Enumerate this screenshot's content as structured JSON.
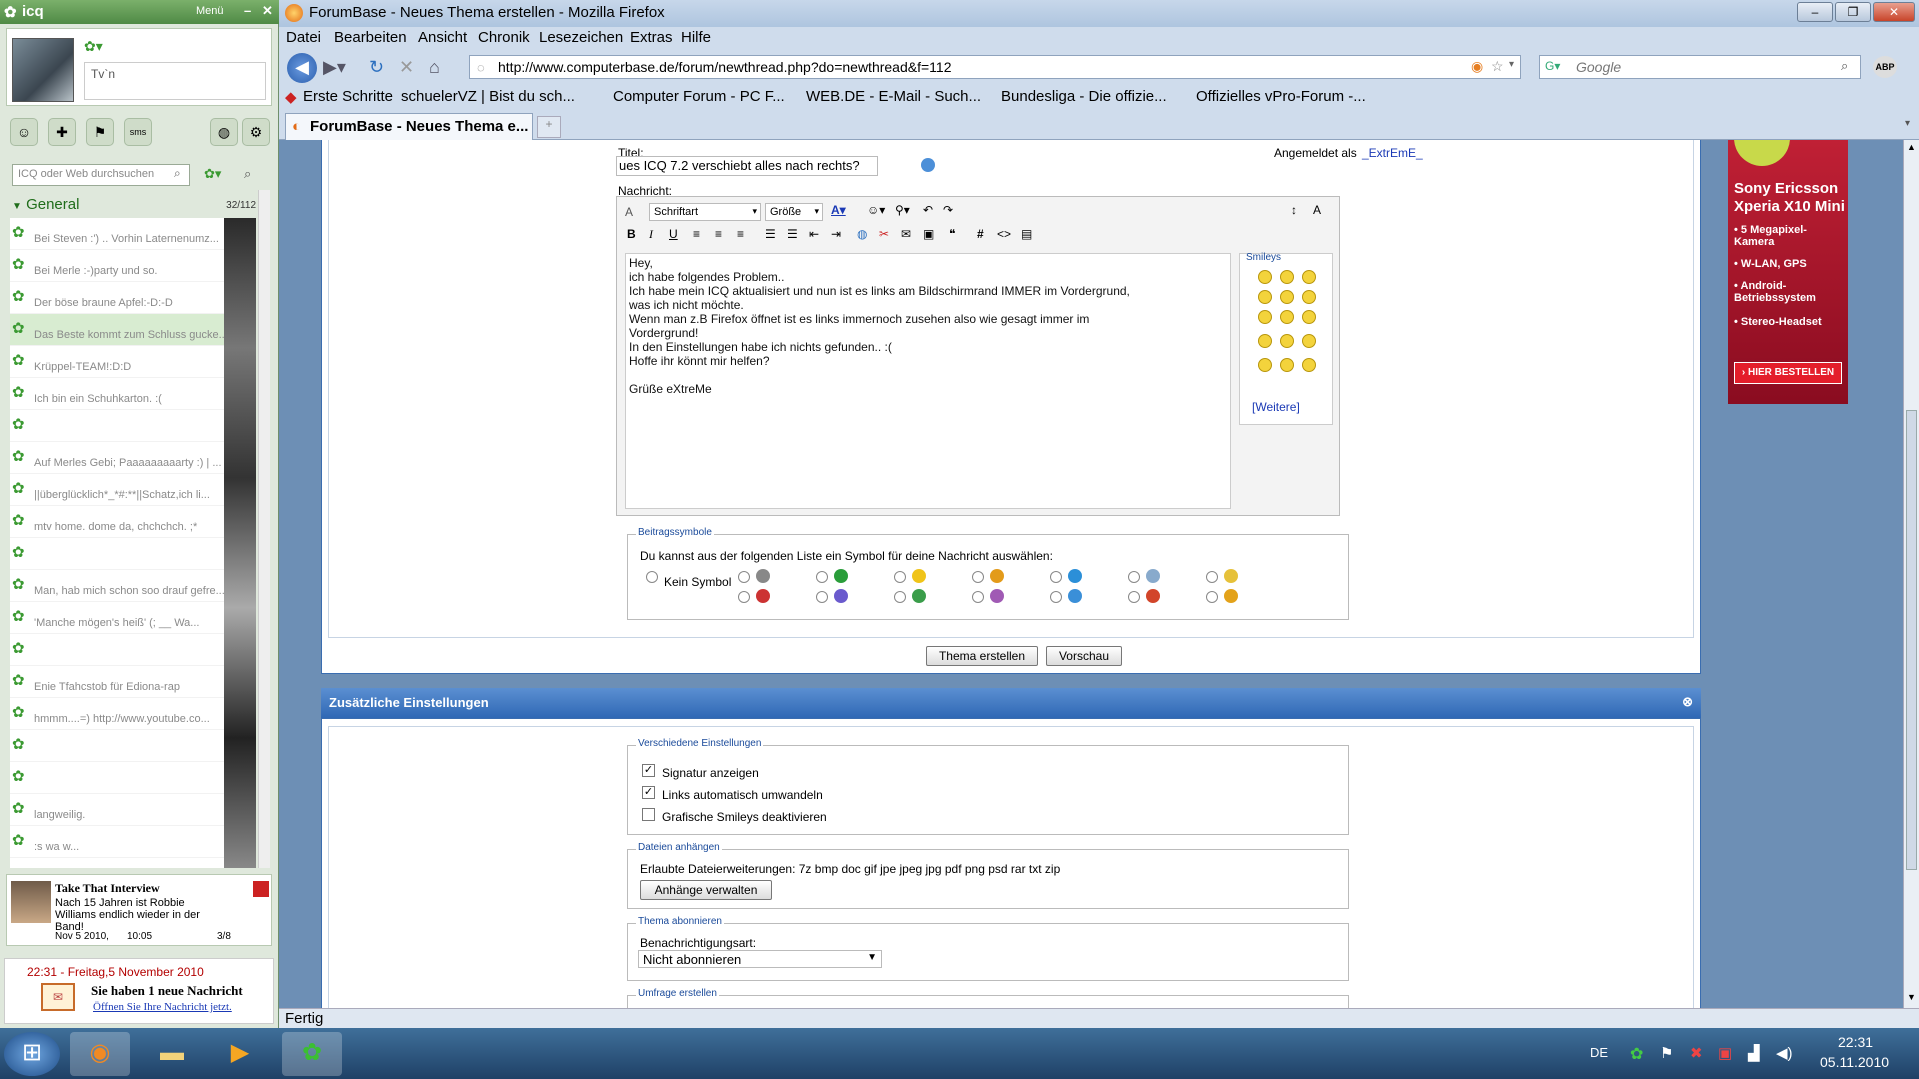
{
  "icq": {
    "title": "icq",
    "menu": "Menü",
    "status": "Tv`n",
    "search_placeholder": "ICQ oder Web durchsuchen",
    "group": "General",
    "group_count": "32/112",
    "contacts": [
      {
        "name": "",
        "msg": "Bei Steven :') .. Vorhin Laternenumz..."
      },
      {
        "name": "",
        "msg": "Bei Merle :-)party und so."
      },
      {
        "name": "",
        "msg": "Der böse braune Apfel:-D:-D"
      },
      {
        "name": "",
        "msg": "Das Beste kommt zum Schluss gucke..."
      },
      {
        "name": "",
        "msg": "Krüppel-TEAM!:D:D"
      },
      {
        "name": "",
        "msg": "Ich bin ein Schuhkarton. :("
      },
      {
        "name": "",
        "msg": ""
      },
      {
        "name": "",
        "msg": "Auf Merles Gebi; Paaaaaaaaarty :) | ..."
      },
      {
        "name": "",
        "msg": "||überglücklich*_*#:**||Schatz,ich li..."
      },
      {
        "name": "",
        "msg": "mtv home. dome da, chchchch. ;*"
      },
      {
        "name": "",
        "msg": ""
      },
      {
        "name": "",
        "msg": "Man, hab mich schon soo drauf gefre..."
      },
      {
        "name": "",
        "msg": "'Manche mögen's heiß' (; __ Wa..."
      },
      {
        "name": "",
        "msg": ""
      },
      {
        "name": "",
        "msg": "Enie Tfahcstob für Ediona-rap"
      },
      {
        "name": "",
        "msg": "hmmm....=) http://www.youtube.co..."
      },
      {
        "name": "",
        "msg": ""
      },
      {
        "name": "",
        "msg": ""
      },
      {
        "name": "",
        "msg": "langweilig."
      },
      {
        "name": "",
        "msg": ":s wa w..."
      }
    ],
    "news": {
      "title": "Take That Interview",
      "text": "Nach 15 Jahren ist Robbie Williams endlich wieder in der Band!",
      "date": "Nov 5 2010,",
      "time": "10:05",
      "nav": "3/8"
    },
    "alert": {
      "time": "22:31 - Freitag,5 November 2010",
      "msg": "Sie haben 1 neue Nachricht",
      "link": "Öffnen Sie Ihre Nachricht jetzt."
    }
  },
  "firefox": {
    "title": "ForumBase - Neues Thema erstellen - Mozilla Firefox",
    "menu": [
      "Datei",
      "Bearbeiten",
      "Ansicht",
      "Chronik",
      "Lesezeichen",
      "Extras",
      "Hilfe"
    ],
    "url": "http://www.computerbase.de/forum/newthread.php?do=newthread&f=112",
    "search_placeholder": "Google",
    "abp": "ABP",
    "bookmarks": [
      "Erste Schritte",
      "schuelerVZ | Bist du sch...",
      "Computer Forum - PC F...",
      "WEB.DE - E-Mail - Such...",
      "Bundesliga - Die offizie...",
      "Offizielles vPro-Forum -..."
    ],
    "tab": "ForumBase - Neues Thema e...",
    "status": "Fertig"
  },
  "form": {
    "title_label": "Titel:",
    "title_value": "ues ICQ 7.2 verschiebt alles nach rechts?",
    "logged_in": "Angemeldet als",
    "user": "_ExtrEmE_",
    "message_label": "Nachricht:",
    "font_select": "Schriftart",
    "size_select": "Größe",
    "message": "Hey,\nich habe folgendes Problem..\nIch habe mein ICQ aktualisiert und nun ist es links am Bildschirmrand IMMER im Vordergrund,\nwas ich nicht möchte.\nWenn man z.B Firefox öffnet ist es links immernoch zusehen also wie gesagt immer im\nVordergrund!\nIn den Einstellungen habe ich nichts gefunden.. :(\nHoffe ihr könnt mir helfen?\n\nGrüße eXtreMe",
    "smileys_title": "Smileys",
    "smileys_more": "[Weitere]",
    "post_icons_title": "Beitragssymbole",
    "post_icons_text": "Du kannst aus der folgenden Liste ein Symbol für deine Nachricht auswählen:",
    "no_icon": "Kein Symbol",
    "submit": "Thema erstellen",
    "preview": "Vorschau",
    "extra_title": "Zusätzliche Einstellungen",
    "misc_title": "Verschiedene Einstellungen",
    "opt_signature": "Signatur anzeigen",
    "opt_links": "Links automatisch umwandeln",
    "opt_smileys": "Grafische Smileys deaktivieren",
    "attach_title": "Dateien anhängen",
    "attach_text": "Erlaubte Dateierweiterungen: 7z bmp doc gif jpe jpeg jpg pdf png psd rar txt zip",
    "attach_btn": "Anhänge verwalten",
    "subscribe_title": "Thema abonnieren",
    "subscribe_label": "Benachrichtigungsart:",
    "subscribe_value": "Nicht abonnieren",
    "poll_title": "Umfrage erstellen"
  },
  "ad": {
    "brand": "Sony Ericsson",
    "model": "Xperia X10 Mini",
    "features": [
      "• 5 Megapixel-Kamera",
      "• W-LAN, GPS",
      "• Android-Betriebssystem",
      "• Stereo-Headset"
    ],
    "cta": "› HIER BESTELLEN"
  },
  "taskbar": {
    "lang": "DE",
    "time": "22:31",
    "date": "05.11.2010"
  }
}
